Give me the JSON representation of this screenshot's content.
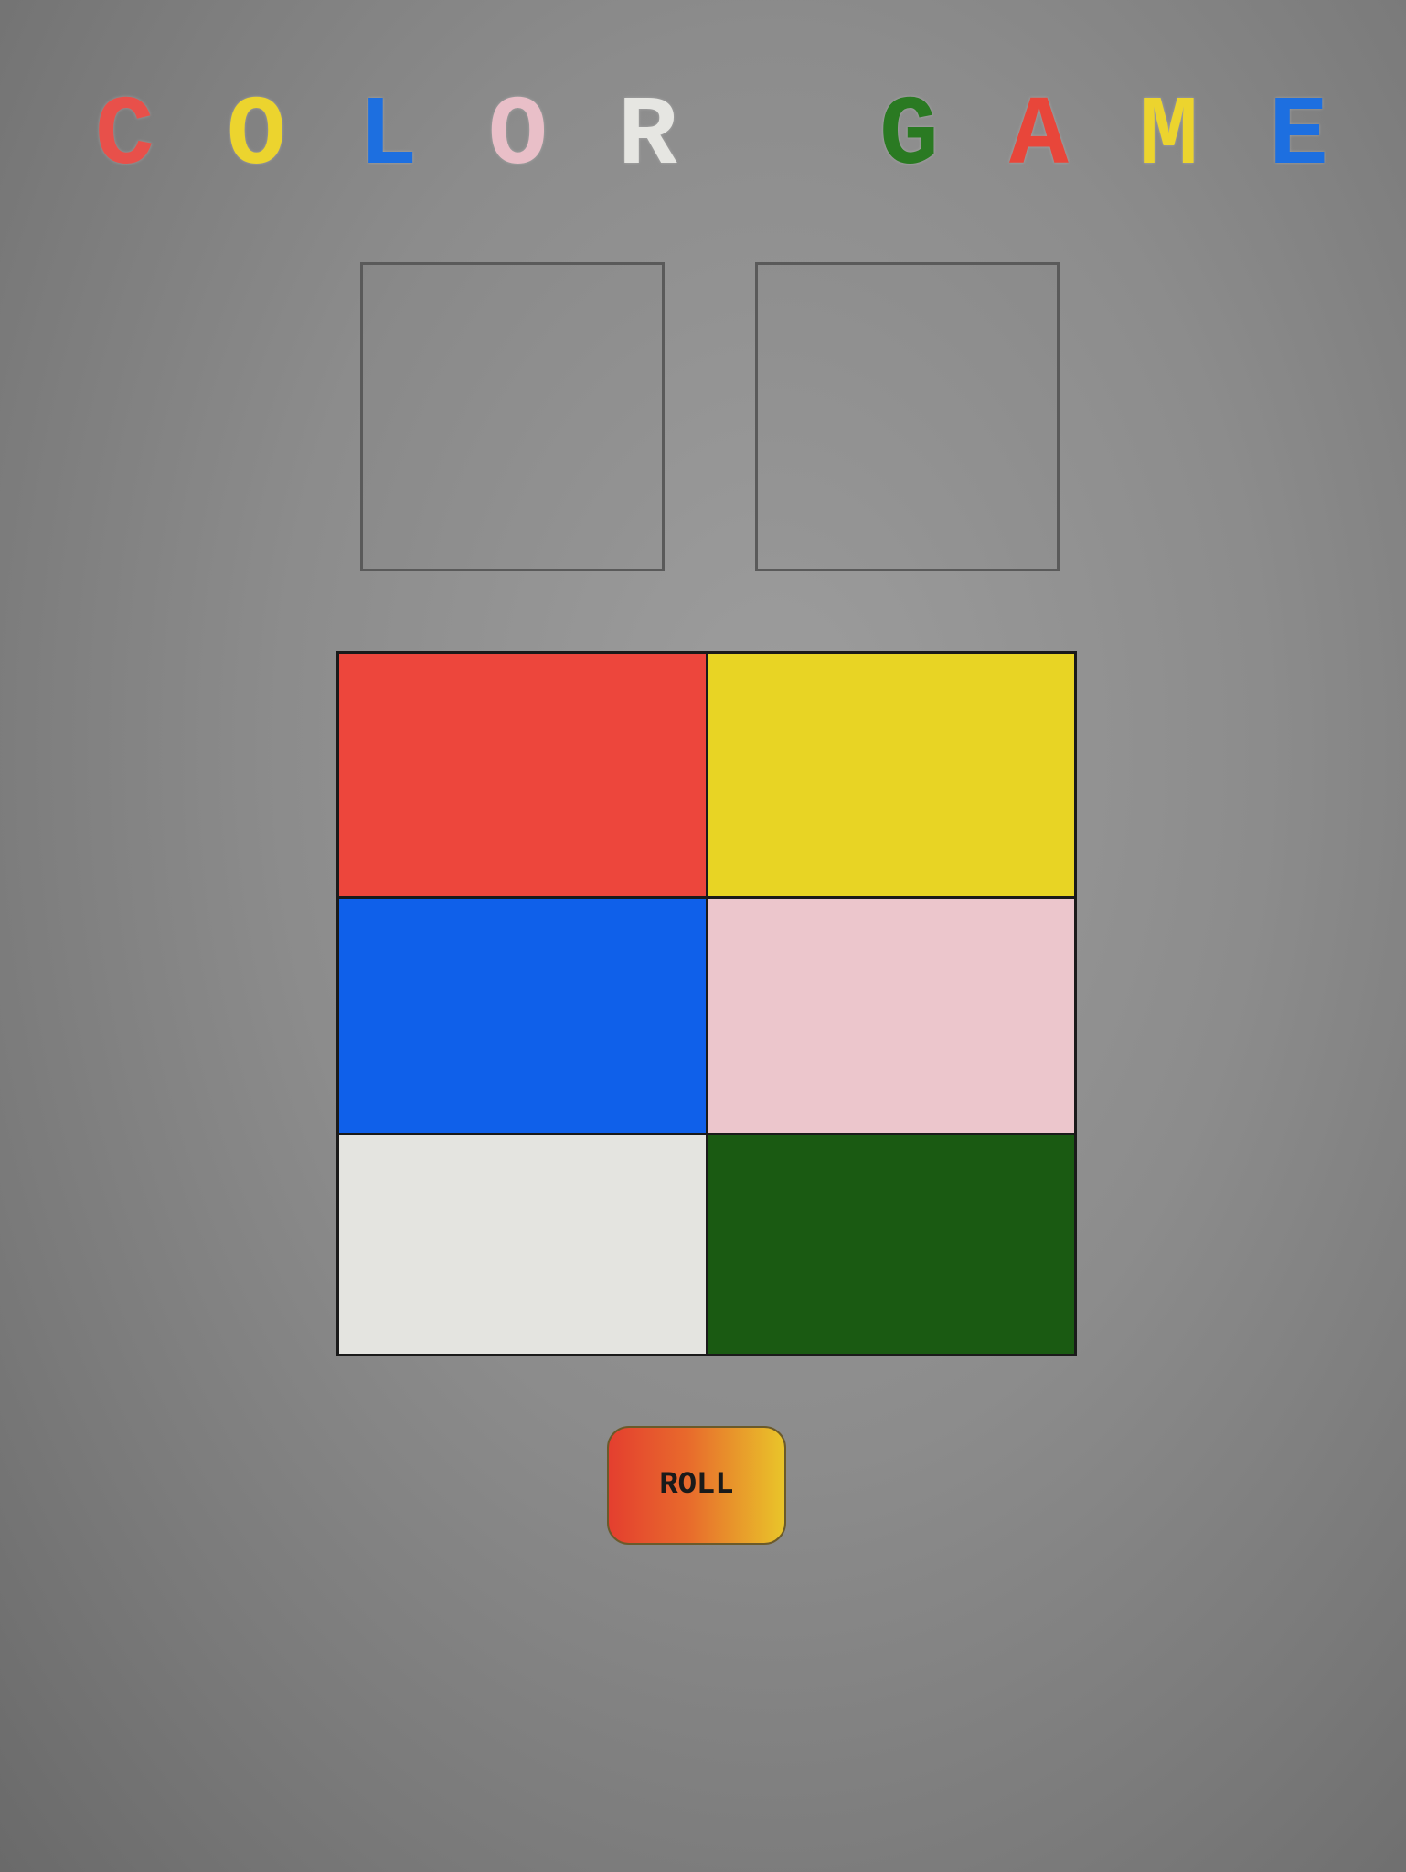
{
  "title": {
    "word1": [
      {
        "char": "C",
        "color": "#e8504a"
      },
      {
        "char": "O",
        "color": "#ecd42e"
      },
      {
        "char": "L",
        "color": "#1d6fe0"
      },
      {
        "char": "O",
        "color": "#e9bfc8"
      },
      {
        "char": "R",
        "color": "#e6e6e2"
      }
    ],
    "word2": [
      {
        "char": "G",
        "color": "#2a7a22"
      },
      {
        "char": "A",
        "color": "#e8463a"
      },
      {
        "char": "M",
        "color": "#ecd42e"
      },
      {
        "char": "E",
        "color": "#1d6fe0"
      }
    ]
  },
  "dice": [
    {
      "value": ""
    },
    {
      "value": ""
    }
  ],
  "board": {
    "cells": [
      {
        "name": "red",
        "color": "#ed463c"
      },
      {
        "name": "yellow",
        "color": "#e8d424"
      },
      {
        "name": "blue",
        "color": "#0f60ea"
      },
      {
        "name": "pink",
        "color": "#ecc6cc"
      },
      {
        "name": "white",
        "color": "#e4e4e0"
      },
      {
        "name": "green",
        "color": "#1a5a12"
      }
    ]
  },
  "roll_button": {
    "label": "ROLL"
  }
}
